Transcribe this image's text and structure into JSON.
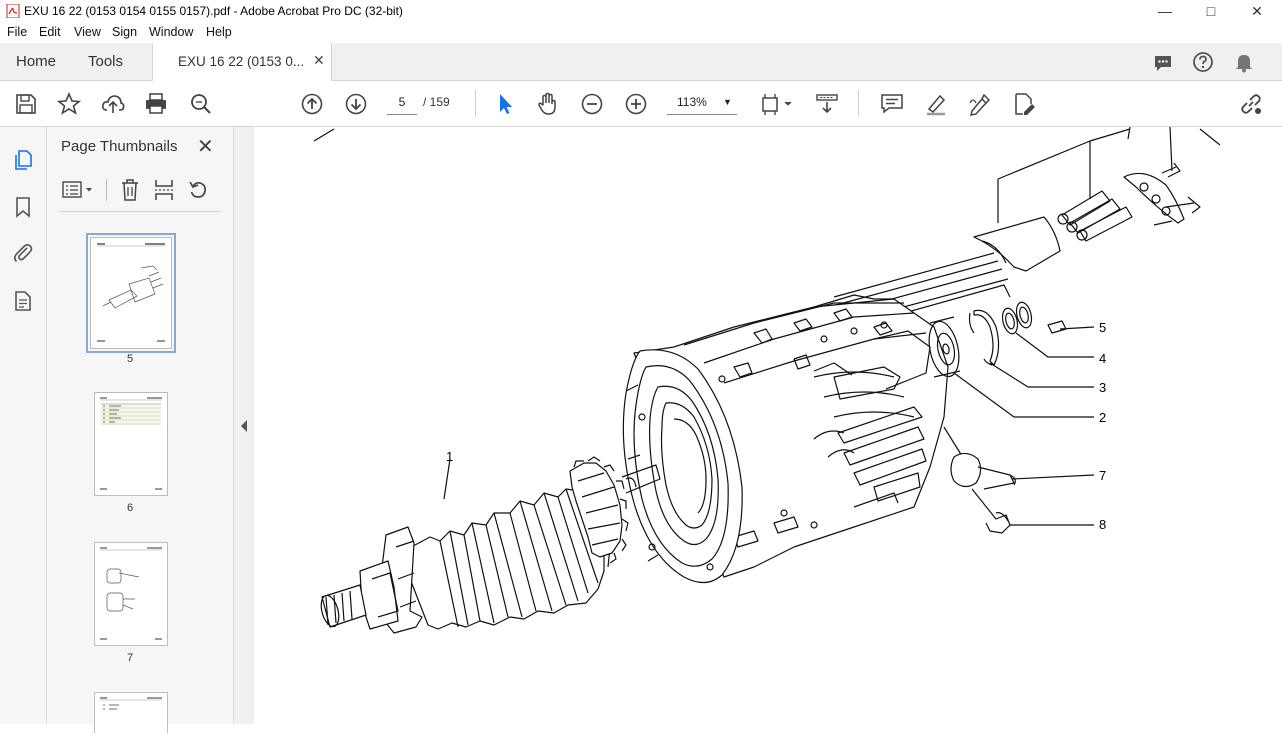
{
  "window": {
    "title": "EXU 16 22 (0153 0154 0155 0157).pdf - Adobe Acrobat Pro DC (32-bit)"
  },
  "menu": [
    "File",
    "Edit",
    "View",
    "Sign",
    "Window",
    "Help"
  ],
  "tabs": {
    "home": "Home",
    "tools": "Tools",
    "document": "EXU 16 22 (0153 0..."
  },
  "toolbar": {
    "current_page": "5",
    "page_total": "/ 159",
    "zoom": "113%"
  },
  "panel": {
    "title": "Page Thumbnails",
    "thumbnails": [
      {
        "page": "5",
        "selected": true
      },
      {
        "page": "6",
        "selected": false
      },
      {
        "page": "7",
        "selected": false
      }
    ]
  },
  "callouts": [
    "1",
    "2",
    "3",
    "4",
    "5",
    "7",
    "8"
  ],
  "colors": {
    "accent": "#1473e6",
    "title_icon": "#d2231f",
    "notification": "#757575"
  }
}
